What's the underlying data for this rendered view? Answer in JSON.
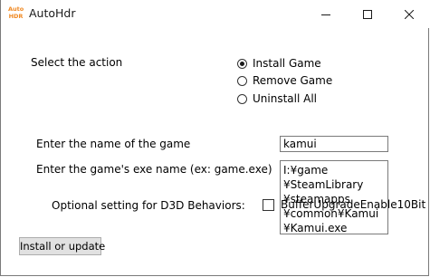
{
  "window": {
    "title": "AutoHdr",
    "icon_text_top": "Auto",
    "icon_text_bottom": "HDR",
    "icon_color": "#f08a24"
  },
  "action": {
    "label": "Select the action",
    "options": [
      {
        "label": "Install Game",
        "checked": true
      },
      {
        "label": "Remove Game",
        "checked": false
      },
      {
        "label": "Uninstall All",
        "checked": false
      }
    ]
  },
  "game_name": {
    "label": "Enter the name of the game",
    "value": "kamui"
  },
  "exe_name": {
    "label": "Enter the game's exe name (ex: game.exe)",
    "lines": [
      "I:¥game",
      "¥SteamLibrary",
      "¥steamapps",
      "¥common¥Kamui",
      "¥Kamui.exe"
    ]
  },
  "d3d": {
    "label": "Optional setting for D3D Behaviors:",
    "checkbox_label": "BufferUpgradeEnable10Bit",
    "checked": false
  },
  "install_button": {
    "label": "Install or update"
  }
}
